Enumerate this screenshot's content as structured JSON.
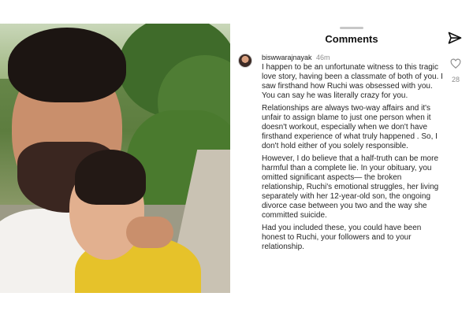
{
  "header": {
    "title": "Comments"
  },
  "icons": {
    "send": "send-icon",
    "like": "heart-outline-icon",
    "avatar": "avatar"
  },
  "comment": {
    "username": "biswwarajnayak",
    "time": "46m",
    "likes": "28",
    "paragraphs": [
      "I happen to be an unfortunate witness to this tragic love story, having been a classmate of both of you. I saw firsthand how Ruchi was obsessed with you. You can say he was literally crazy for you.",
      "Relationships are always two-way affairs and it's unfair to assign blame to just one person when it doesn't workout, especially when we don't have firsthand experience of what truly happened . So, I don't hold either of you solely responsible.",
      "However, I do believe that a half-truth can be more harmful than a complete lie. In your obituary, you omitted significant aspects— the broken relationship, Ruchi's emotional struggles, her living separately with her 12-year-old son, the ongoing divorce case between you two and the way she committed suicide.",
      "Had you included these, you could have been honest to Ruchi, your followers and to your relationship."
    ]
  },
  "colors": {
    "text": "#262626",
    "muted": "#8e8e8e",
    "background": "#ffffff"
  }
}
